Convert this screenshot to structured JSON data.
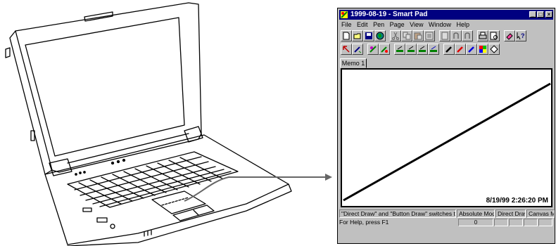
{
  "window": {
    "title": "1999-08-19 - Smart Pad",
    "controls": {
      "minimize": "_",
      "maximize": "□",
      "close": "×"
    }
  },
  "menu": [
    "File",
    "Edit",
    "Pen",
    "Page",
    "View",
    "Window",
    "Help"
  ],
  "toolbar1": [
    {
      "name": "new-icon",
      "enabled": true
    },
    {
      "name": "open-folder-icon",
      "enabled": true
    },
    {
      "name": "save-icon",
      "enabled": true
    },
    {
      "name": "globe-icon",
      "enabled": true
    },
    {
      "name": "cut-icon",
      "enabled": false
    },
    {
      "name": "copy-icon",
      "enabled": false
    },
    {
      "name": "paste-icon",
      "enabled": false
    },
    {
      "name": "page-icon",
      "enabled": false
    },
    {
      "name": "delete-page-icon",
      "enabled": false
    },
    {
      "name": "undo-icon",
      "enabled": false
    },
    {
      "name": "redo-icon",
      "enabled": false
    },
    {
      "name": "print-icon",
      "enabled": true
    },
    {
      "name": "print-preview-icon",
      "enabled": true
    },
    {
      "name": "eraser-icon",
      "enabled": true
    },
    {
      "name": "help-pointer-icon",
      "enabled": true
    }
  ],
  "toolbar2": [
    {
      "name": "select-arrow-icon",
      "enabled": true
    },
    {
      "name": "pen-select-icon",
      "enabled": true
    },
    {
      "name": "pen-draw-icon",
      "enabled": true
    },
    {
      "name": "pen-recycle-icon",
      "enabled": true
    },
    {
      "name": "pen-style-1-icon",
      "enabled": true
    },
    {
      "name": "pen-style-2-icon",
      "enabled": true
    },
    {
      "name": "pen-style-3-icon",
      "enabled": true
    },
    {
      "name": "pen-style-4-icon",
      "enabled": true
    },
    {
      "name": "black-pen-icon",
      "enabled": true
    },
    {
      "name": "red-pen-icon",
      "enabled": true
    },
    {
      "name": "blue-pen-icon",
      "enabled": true
    },
    {
      "name": "color-palette-icon",
      "enabled": true
    },
    {
      "name": "pen-eraser-icon",
      "enabled": true
    }
  ],
  "tab": {
    "label": "Memo 1"
  },
  "canvas": {
    "timestamp": "8/19/99 2:26:20 PM"
  },
  "status": {
    "message": "\"Direct Draw\" and \"Button Draw\" switches temporarily",
    "mode": "Absolute Mode",
    "draw": "Direct Draw",
    "map": "Canvas Map",
    "help": "For Help, press F1",
    "counter": "0"
  },
  "colors": {
    "title_bar": "#000080",
    "window_face": "#c0c0c0",
    "pointer_arrow": "#666666"
  }
}
